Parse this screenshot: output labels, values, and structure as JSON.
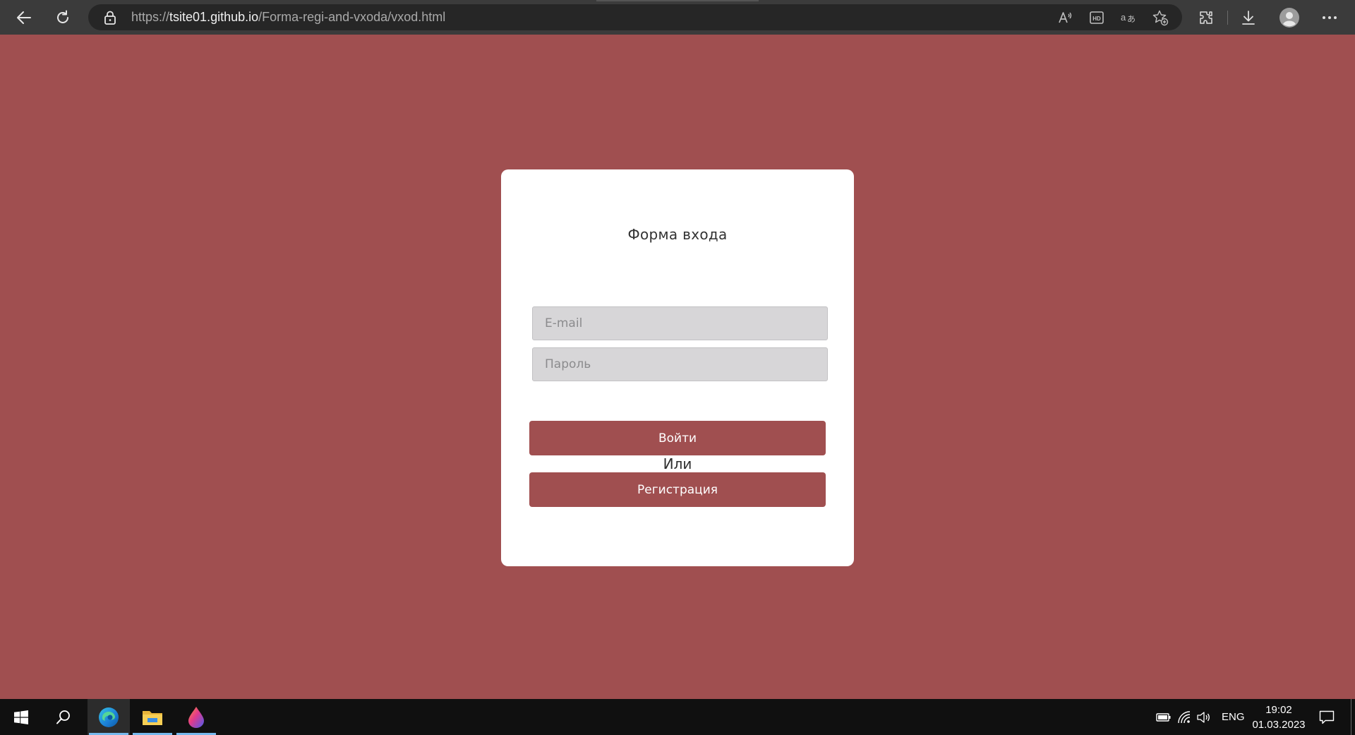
{
  "browser": {
    "url_scheme": "https://",
    "url_host": "tsite01.github.io",
    "url_path": "/Forma-regi-and-vxoda/vxod.html",
    "icons": {
      "back": "back-arrow-icon",
      "refresh": "refresh-icon",
      "lock": "lock-icon",
      "read_aloud": "read-aloud-icon",
      "hd": "hd-video-icon",
      "translate": "translate-icon",
      "favorites": "add-favorite-icon",
      "extensions": "extensions-icon",
      "downloads": "download-icon",
      "profile": "profile-avatar-icon",
      "menu": "more-menu-icon"
    }
  },
  "login_form": {
    "title": "Форма входа",
    "email_placeholder": "E-mail",
    "email_value": "",
    "password_placeholder": "Пароль",
    "password_value": "",
    "login_label": "Войти",
    "or_label": "Или",
    "register_label": "Регистрация"
  },
  "taskbar": {
    "apps": [
      "start-icon",
      "search-icon",
      "edge-browser-icon",
      "file-explorer-icon",
      "paint-app-icon"
    ],
    "language": "ENG",
    "time": "19:02",
    "date": "01.03.2023"
  },
  "colors": {
    "page_background": "#a04f50",
    "card_background": "#ffffff",
    "button_background": "#a04f50",
    "input_background": "#d7d6d8",
    "chrome_background": "#3b3b3b",
    "taskbar_background": "#101010"
  }
}
